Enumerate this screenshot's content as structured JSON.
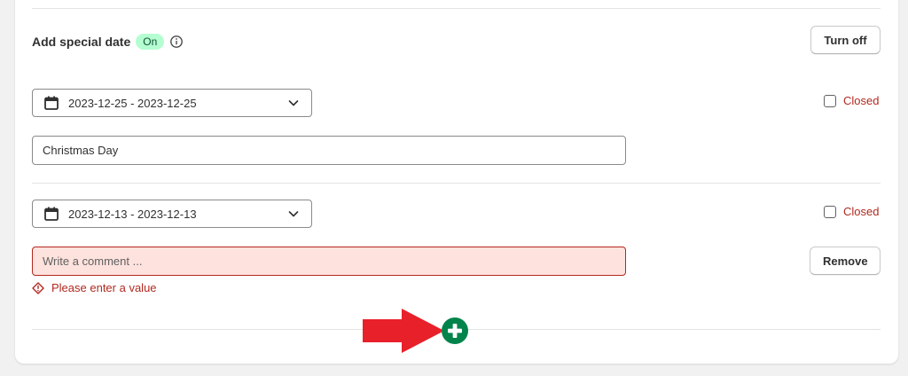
{
  "section": {
    "title": "Add special date",
    "status_badge": "On",
    "turn_off_label": "Turn off"
  },
  "special_dates": [
    {
      "date_range": "2023-12-25 - 2023-12-25",
      "closed_label": "Closed",
      "closed_checked": false,
      "comment_value": "Christmas Day",
      "comment_placeholder": "Write a comment ..."
    },
    {
      "date_range": "2023-12-13 - 2023-12-13",
      "closed_label": "Closed",
      "closed_checked": false,
      "comment_value": "",
      "comment_placeholder": "Write a comment ...",
      "error_message": "Please enter a value",
      "remove_label": "Remove"
    }
  ],
  "icons": {
    "info": "info-icon",
    "calendar": "calendar-icon",
    "chevron": "chevron-down-icon",
    "error": "error-icon",
    "add": "plus-circle-icon",
    "arrow": "arrow-right-icon"
  },
  "colors": {
    "badge_bg": "#b4fed2",
    "badge_text": "#0c5132",
    "error": "#b2291f",
    "error_bg": "#fee2dd",
    "add_button": "#00844b",
    "annotation_arrow": "#e8202a"
  }
}
